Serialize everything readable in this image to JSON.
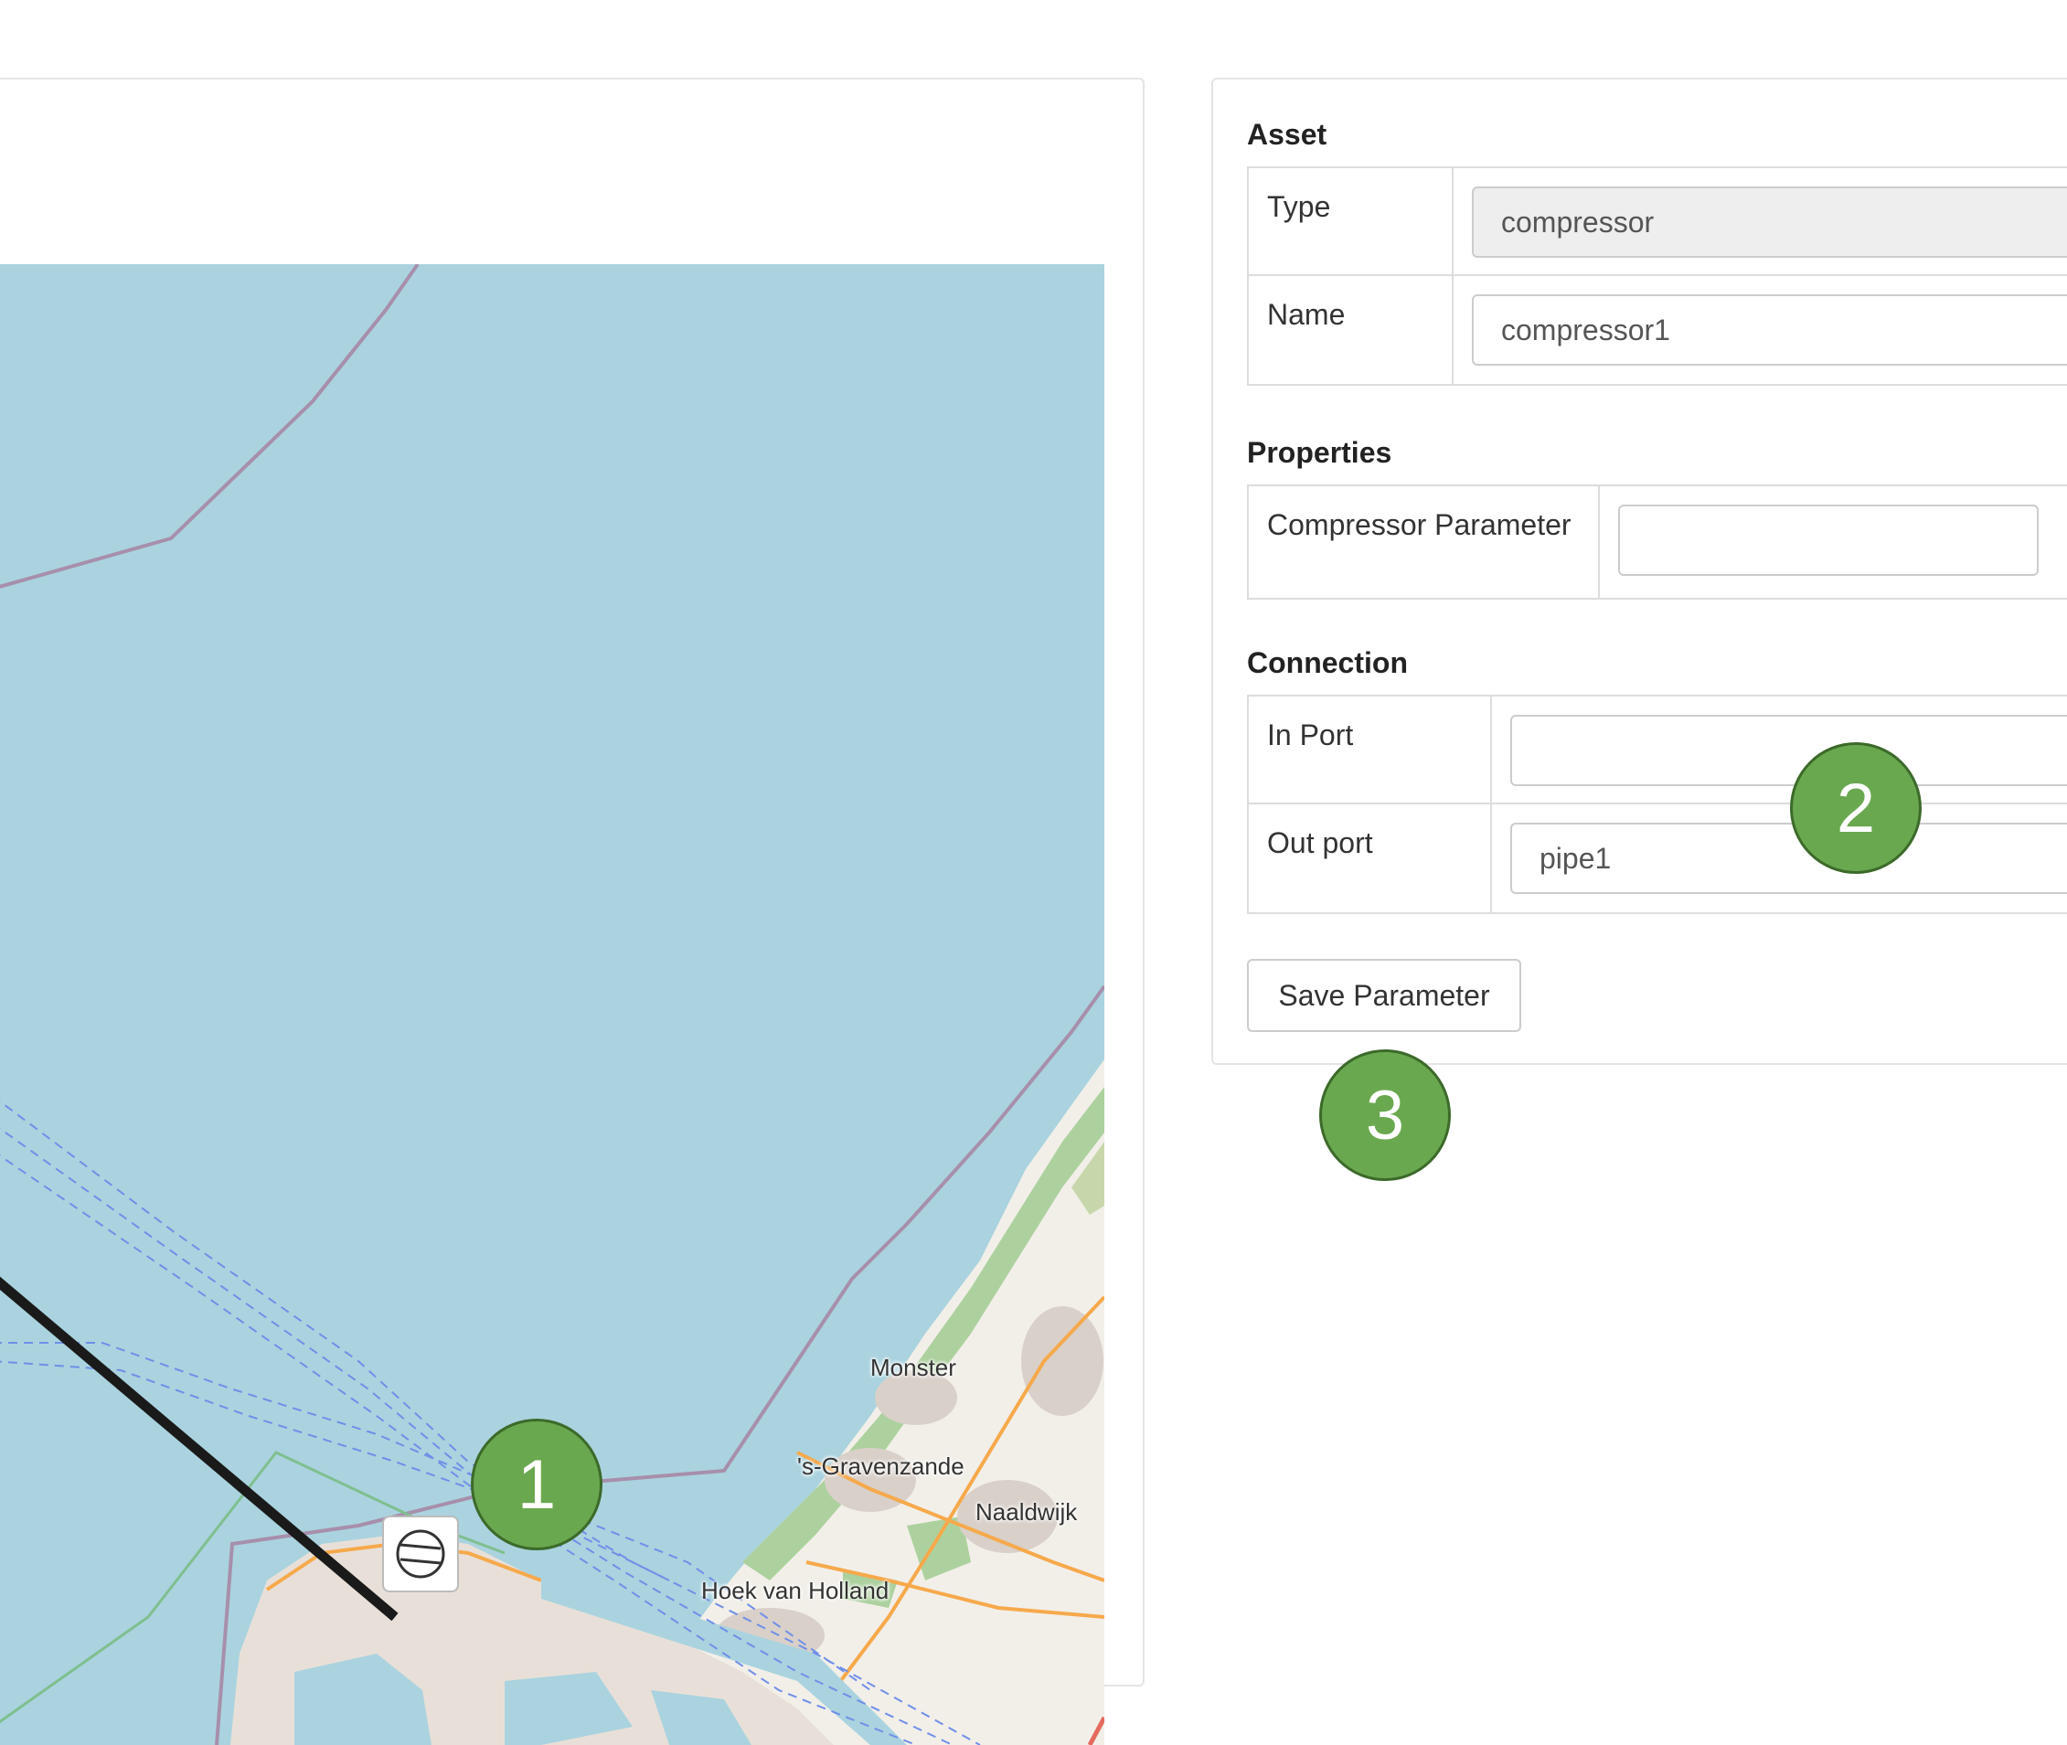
{
  "map": {
    "labels": {
      "monster": "Monster",
      "gravenzande": "'s-Gravenzande",
      "naaldwijk": "Naaldwijk",
      "hoek": "Hoek van Holland"
    },
    "marker_icon": "compressor-icon"
  },
  "badges": {
    "one": "1",
    "two": "2",
    "three": "3"
  },
  "asset": {
    "title": "Asset",
    "type_label": "Type",
    "type_value": "compressor",
    "name_label": "Name",
    "name_value": "compressor1"
  },
  "properties": {
    "title": "Properties",
    "param_label": "Compressor Parameter",
    "param_value": ""
  },
  "connection": {
    "title": "Connection",
    "in_label": "In Port",
    "in_value": "",
    "out_label": "Out port",
    "out_value": "pipe1"
  },
  "save_label": "Save Parameter",
  "colors": {
    "water": "#aad3df",
    "land": "#f2efe9",
    "badge": "#6aa84f",
    "pipe": "#1a1a1a"
  }
}
